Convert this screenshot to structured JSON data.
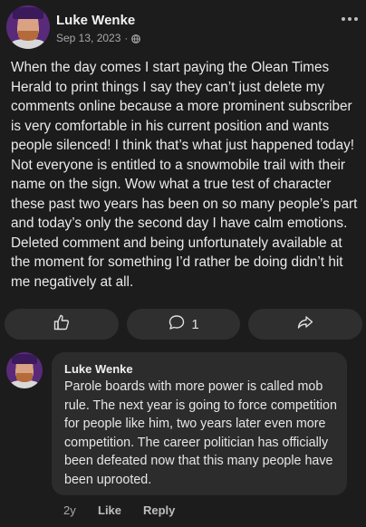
{
  "post": {
    "author": "Luke Wenke",
    "date": "Sep 13, 2023",
    "separator": "·",
    "visibility_icon": "globe-icon",
    "more_icon": "more-horizontal-icon",
    "body": "When the day comes I start paying the Olean Times Herald to print things I say they can’t just delete my comments online because a more prominent subscriber is very comfortable in his current position and wants people silenced!  I think that’s what just happened today!  Not everyone is entitled to a snowmobile trail with their name on the sign.  Wow what a true test of character these past two years has been on so many people’s part and today’s only the second day I have calm emotions.  Deleted comment and being unfortunately available at the moment for something I’d rather be doing didn’t hit me negatively at all."
  },
  "actions": {
    "like_icon": "thumbs-up-icon",
    "comment_icon": "comment-icon",
    "comment_count": "1",
    "share_icon": "share-icon"
  },
  "comment": {
    "author": "Luke Wenke",
    "text": "Parole boards with more power is called mob rule.  The next year is going to force competition for people like him, two years later even more competition.  The career politician has officially been defeated now that this many people have been uprooted.",
    "age": "2y",
    "like_label": "Like",
    "reply_label": "Reply"
  }
}
